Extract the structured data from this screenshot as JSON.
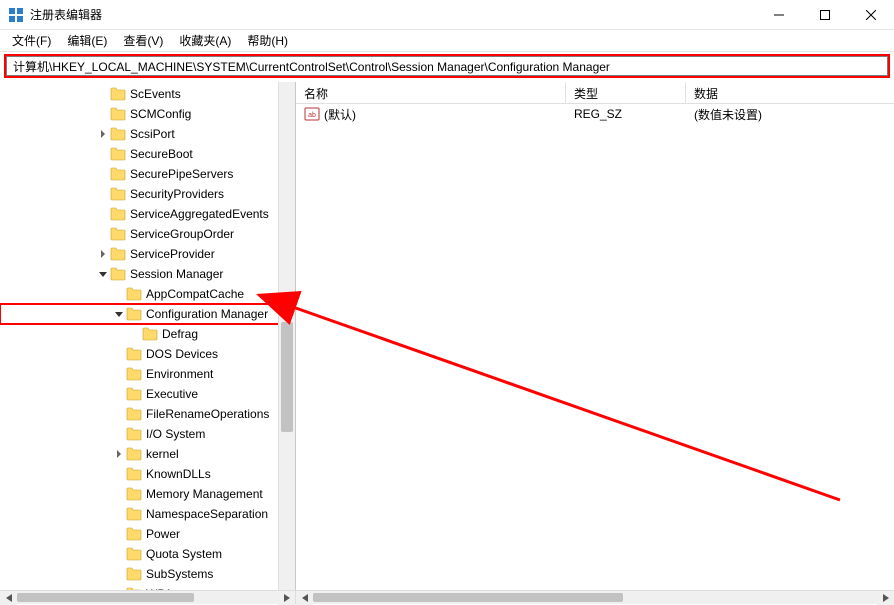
{
  "titlebar": {
    "title": "注册表编辑器"
  },
  "menu": {
    "file": "文件(F)",
    "edit": "编辑(E)",
    "view": "查看(V)",
    "favorites": "收藏夹(A)",
    "help": "帮助(H)"
  },
  "address": "计算机\\HKEY_LOCAL_MACHINE\\SYSTEM\\CurrentControlSet\\Control\\Session Manager\\Configuration Manager",
  "tree": {
    "items": [
      {
        "indent": 96,
        "chev": "none",
        "label": "ScEvents"
      },
      {
        "indent": 96,
        "chev": "none",
        "label": "SCMConfig"
      },
      {
        "indent": 96,
        "chev": "closed",
        "label": "ScsiPort"
      },
      {
        "indent": 96,
        "chev": "none",
        "label": "SecureBoot"
      },
      {
        "indent": 96,
        "chev": "none",
        "label": "SecurePipeServers"
      },
      {
        "indent": 96,
        "chev": "none",
        "label": "SecurityProviders"
      },
      {
        "indent": 96,
        "chev": "none",
        "label": "ServiceAggregatedEvents"
      },
      {
        "indent": 96,
        "chev": "none",
        "label": "ServiceGroupOrder"
      },
      {
        "indent": 96,
        "chev": "closed",
        "label": "ServiceProvider"
      },
      {
        "indent": 96,
        "chev": "open",
        "label": "Session Manager"
      },
      {
        "indent": 112,
        "chev": "none",
        "label": "AppCompatCache"
      },
      {
        "indent": 112,
        "chev": "open",
        "label": "Configuration Manager",
        "highlight": true
      },
      {
        "indent": 128,
        "chev": "none",
        "label": "Defrag"
      },
      {
        "indent": 112,
        "chev": "none",
        "label": "DOS Devices"
      },
      {
        "indent": 112,
        "chev": "none",
        "label": "Environment"
      },
      {
        "indent": 112,
        "chev": "none",
        "label": "Executive"
      },
      {
        "indent": 112,
        "chev": "none",
        "label": "FileRenameOperations"
      },
      {
        "indent": 112,
        "chev": "none",
        "label": "I/O System"
      },
      {
        "indent": 112,
        "chev": "closed",
        "label": "kernel"
      },
      {
        "indent": 112,
        "chev": "none",
        "label": "KnownDLLs"
      },
      {
        "indent": 112,
        "chev": "none",
        "label": "Memory Management"
      },
      {
        "indent": 112,
        "chev": "none",
        "label": "NamespaceSeparation"
      },
      {
        "indent": 112,
        "chev": "none",
        "label": "Power"
      },
      {
        "indent": 112,
        "chev": "none",
        "label": "Quota System"
      },
      {
        "indent": 112,
        "chev": "none",
        "label": "SubSystems"
      },
      {
        "indent": 112,
        "chev": "closed",
        "label": "WPA"
      }
    ]
  },
  "list": {
    "columns": {
      "name": "名称",
      "type": "类型",
      "data": "数据"
    },
    "rows": [
      {
        "name": "(默认)",
        "type": "REG_SZ",
        "data": "(数值未设置)"
      }
    ]
  }
}
